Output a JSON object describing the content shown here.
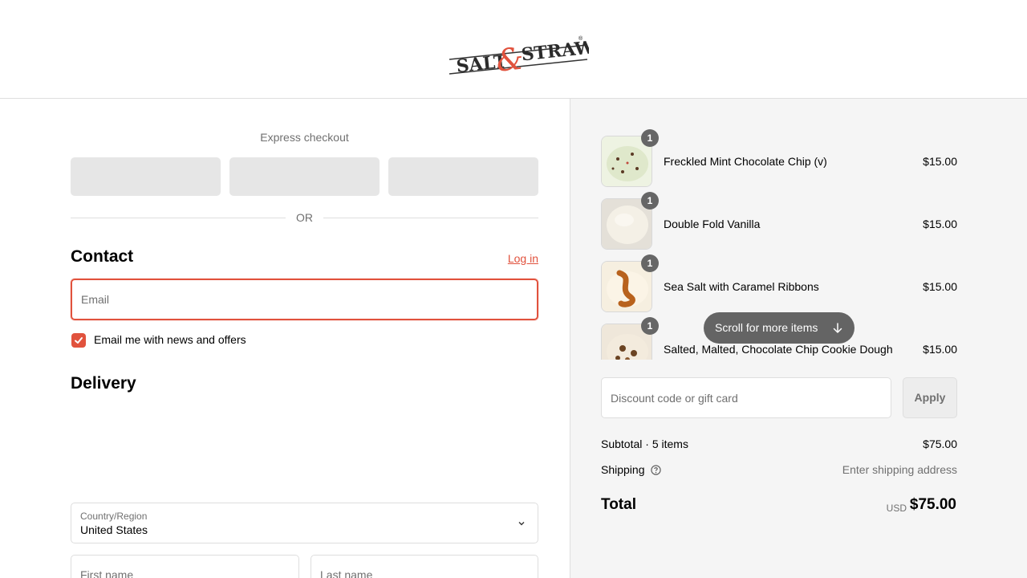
{
  "brand": {
    "logo_text_left": "SALT",
    "logo_ampersand": "&",
    "logo_text_right": "STRAW",
    "logo_mark": "®"
  },
  "colors": {
    "accent": "#e1523d",
    "panel_bg": "#f5f5f5",
    "express_btn": "#e6e6e6"
  },
  "express": {
    "title": "Express checkout",
    "or_label": "OR"
  },
  "contact": {
    "title": "Contact",
    "login_label": "Log in",
    "email_placeholder": "Email",
    "newsletter_label": "Email me with news and offers",
    "newsletter_checked": true
  },
  "delivery": {
    "title": "Delivery",
    "country_label": "Country/Region",
    "country_value": "United States",
    "first_name_placeholder": "First name",
    "last_name_placeholder": "Last name"
  },
  "cart": {
    "items": [
      {
        "name": "Freckled Mint Chocolate Chip (v)",
        "price": "$15.00",
        "qty": "1"
      },
      {
        "name": "Double Fold Vanilla",
        "price": "$15.00",
        "qty": "1"
      },
      {
        "name": "Sea Salt with Caramel Ribbons",
        "price": "$15.00",
        "qty": "1"
      },
      {
        "name": "Salted, Malted, Chocolate Chip Cookie Dough",
        "price": "$15.00",
        "qty": "1"
      }
    ],
    "scroll_hint": "Scroll for more items",
    "discount_placeholder": "Discount code or gift card",
    "apply_label": "Apply",
    "subtotal_label": "Subtotal · 5 items",
    "subtotal_value": "$75.00",
    "shipping_label": "Shipping",
    "shipping_value": "Enter shipping address",
    "total_label": "Total",
    "currency": "USD",
    "total_value": "$75.00"
  }
}
